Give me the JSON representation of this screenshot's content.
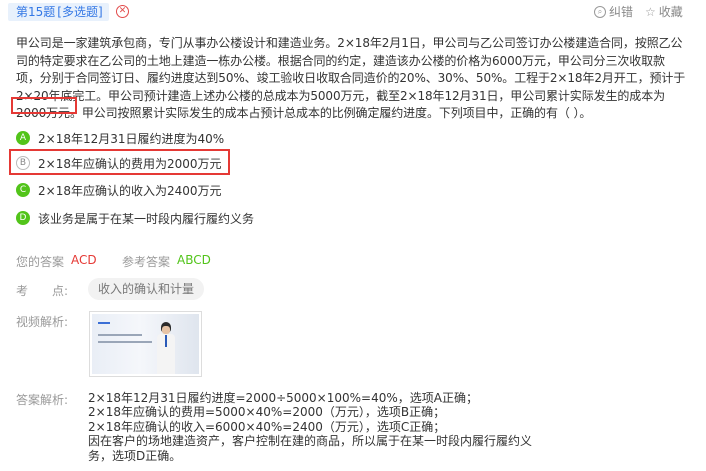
{
  "header": {
    "question_num": "第15题",
    "question_type": "[多选题]",
    "close_icon": "close-circle-icon",
    "correct_label": "纠错",
    "favorite_label": "收藏"
  },
  "question": {
    "lines": [
      "甲公司是一家建筑承包商，专门从事办公楼设计和建造业务。2×18年2月1日，甲公司与乙公司签订办公楼建造合同，按照乙公",
      "司的特定要求在乙公司的土地上建造一栋办公楼。根据合同的约定，建造该办公楼的价格为6000万元，甲公司分三次收取款",
      "项，分别于合同签订日、履约进度达到50%、竣工验收日收取合同造价的20%、30%、50%。工程于2×18年2月开工，预计于",
      "2×20年底完工。甲公司预计建造上述办公楼的总成本为5000万元，截至2×18年12月31日，甲公司累计实际发生的成本为"
    ],
    "last_highlight": "2000万元。",
    "last_rest": "甲公司按照累计实际发生的成本占预计总成本的比例确定履约进度。下列项目中，正确的有（ ）。"
  },
  "options": [
    {
      "letter": "A",
      "text": "2×18年12月31日履约进度为40%",
      "state": "correct"
    },
    {
      "letter": "B",
      "text": "2×18年应确认的费用为2000万元",
      "state": "missed"
    },
    {
      "letter": "C",
      "text": "2×18年应确认的收入为2400万元",
      "state": "correct"
    },
    {
      "letter": "D",
      "text": "该业务是属于在某一时段内履行履约义务",
      "state": "correct"
    }
  ],
  "answers": {
    "your_label": "您的答案",
    "your_value": "ACD",
    "ref_label": "参考答案",
    "ref_value": "ABCD"
  },
  "knowledge": {
    "label": "考　　点:",
    "value": "收入的确认和计量"
  },
  "video": {
    "label": "视频解析:"
  },
  "analysis": {
    "label": "答案解析:",
    "lines": [
      "2×18年12月31日履约进度=2000÷5000×100%=40%，选项A正确；",
      "2×18年应确认的费用=5000×40%=2000（万元），选项B正确；",
      "2×18年应确认的收入=6000×40%=2400（万元），选项C正确；",
      "因在客户的场地建造资产，客户控制在建的商品，所以属于在某一时段内履行履约义",
      "务，选项D正确。"
    ]
  },
  "colors": {
    "accent_blue": "#3478e5",
    "error_red": "#e53935",
    "success_green": "#52c41a"
  }
}
